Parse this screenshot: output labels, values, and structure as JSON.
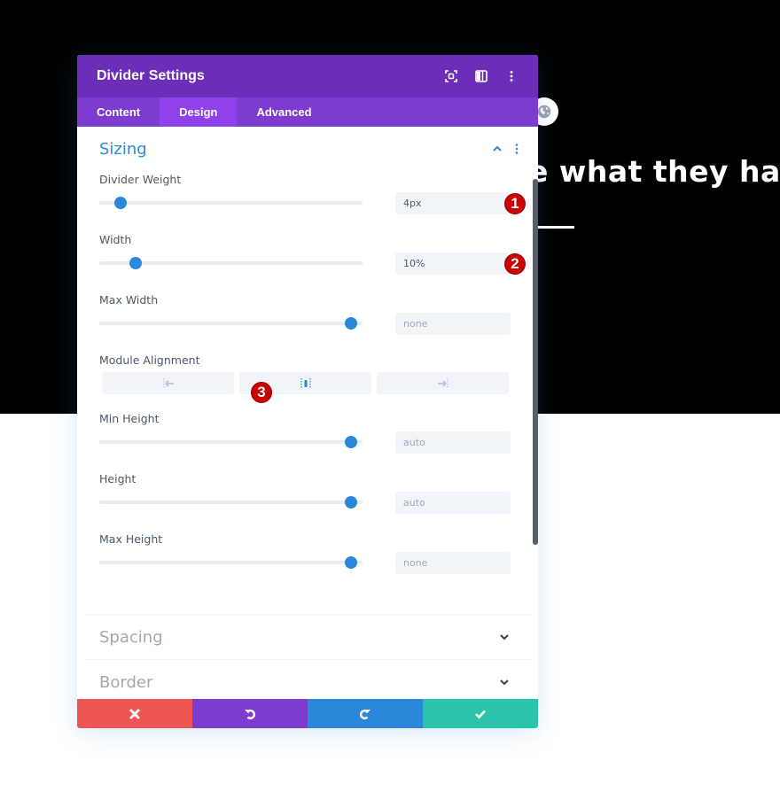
{
  "background": {
    "headline": "e what they have",
    "globe_icon": "globe-icon"
  },
  "panel": {
    "title": "Divider Settings",
    "header_icons": [
      "fullscreen-icon",
      "split-view-icon",
      "more-options-icon"
    ],
    "tabs": [
      {
        "label": "Content",
        "active": false
      },
      {
        "label": "Design",
        "active": true
      },
      {
        "label": "Advanced",
        "active": false
      }
    ],
    "sections": {
      "sizing": {
        "title": "Sizing",
        "expanded": true,
        "fields": [
          {
            "label": "Divider Weight",
            "value": "4px",
            "slider_fraction": 0.06,
            "is_placeholder": false,
            "badge": "1"
          },
          {
            "label": "Width",
            "value": "10%",
            "slider_fraction": 0.12,
            "is_placeholder": false,
            "badge": "2"
          },
          {
            "label": "Max Width",
            "value": "none",
            "slider_fraction": 0.98,
            "is_placeholder": true,
            "badge": null
          }
        ],
        "alignment": {
          "label": "Module Alignment",
          "options": [
            "left",
            "center",
            "right"
          ],
          "selected": "center",
          "badge": "3"
        },
        "fields_after": [
          {
            "label": "Min Height",
            "value": "auto",
            "slider_fraction": 0.98,
            "is_placeholder": true
          },
          {
            "label": "Height",
            "value": "auto",
            "slider_fraction": 0.98,
            "is_placeholder": true
          },
          {
            "label": "Max Height",
            "value": "none",
            "slider_fraction": 0.98,
            "is_placeholder": true
          }
        ]
      },
      "spacing": {
        "title": "Spacing",
        "expanded": false
      },
      "border": {
        "title": "Border",
        "expanded": false
      }
    },
    "footer": {
      "cancel_icon": "close-icon",
      "undo_icon": "undo-icon",
      "redo_icon": "redo-icon",
      "save_icon": "check-icon",
      "colors": {
        "cancel": "#ef5555",
        "undo": "#7e3bd0",
        "redo": "#2b87da",
        "save": "#29c4a9"
      }
    }
  },
  "colors": {
    "header": "#6c2eb9",
    "tabs": "#7e3bd0",
    "active_tab": "#8f42ec",
    "accent": "#2b87da",
    "badge": "#cc0000"
  }
}
